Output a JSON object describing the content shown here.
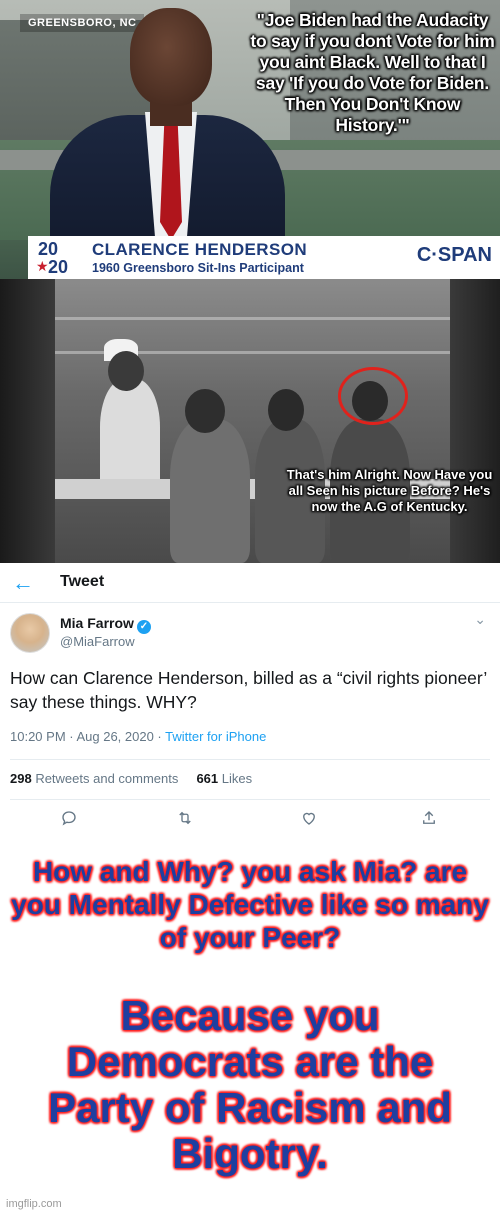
{
  "panel1": {
    "location": "GREENSBORO, NC",
    "quote": "\"Joe Biden had the Audacity to say if you dont Vote for him you aint Black. Well to that I say 'If you do Vote for Biden. Then You Don't Know History.'\"",
    "lower_third": {
      "logo_top": "20",
      "logo_bottom": "20",
      "name": "CLARENCE HENDERSON",
      "subtitle": "1960 Greensboro Sit-Ins Participant",
      "network": "C·SPAN"
    }
  },
  "panel2": {
    "caption": "That's him Alright. Now Have you all Seen his picture Before? He's now the A.G of Kentucky."
  },
  "tweet": {
    "header_title": "Tweet",
    "display_name": "Mia Farrow",
    "handle": "@MiaFarrow",
    "text": "How can Clarence Henderson, billed as a “civil rights pioneer’ say these things. WHY?",
    "time": "10:20 PM · Aug 26, 2020 · ",
    "source": "Twitter for iPhone",
    "retweets_count": "298",
    "retweets_label": " Retweets and comments",
    "likes_count": "661",
    "likes_label": " Likes",
    "icons": [
      "back-arrow-icon",
      "verified-icon",
      "chevron-down-icon",
      "reply-icon",
      "retweet-icon",
      "like-icon",
      "share-icon"
    ]
  },
  "panel4": {
    "red_text": "How and Why? you ask Mia? are you Mentally Defective like so many of your Peer?",
    "blue_text": "Because you Democrats are the Party of Racism and Bigotry.",
    "watermark": "imgflip.com"
  },
  "colors": {
    "twitter_blue": "#1da1f2",
    "cspan_blue": "#1f3c7a",
    "headline_blue": "#1e3fa0",
    "headline_glow_red": "#ff2020",
    "circle_red": "#e0221c"
  }
}
